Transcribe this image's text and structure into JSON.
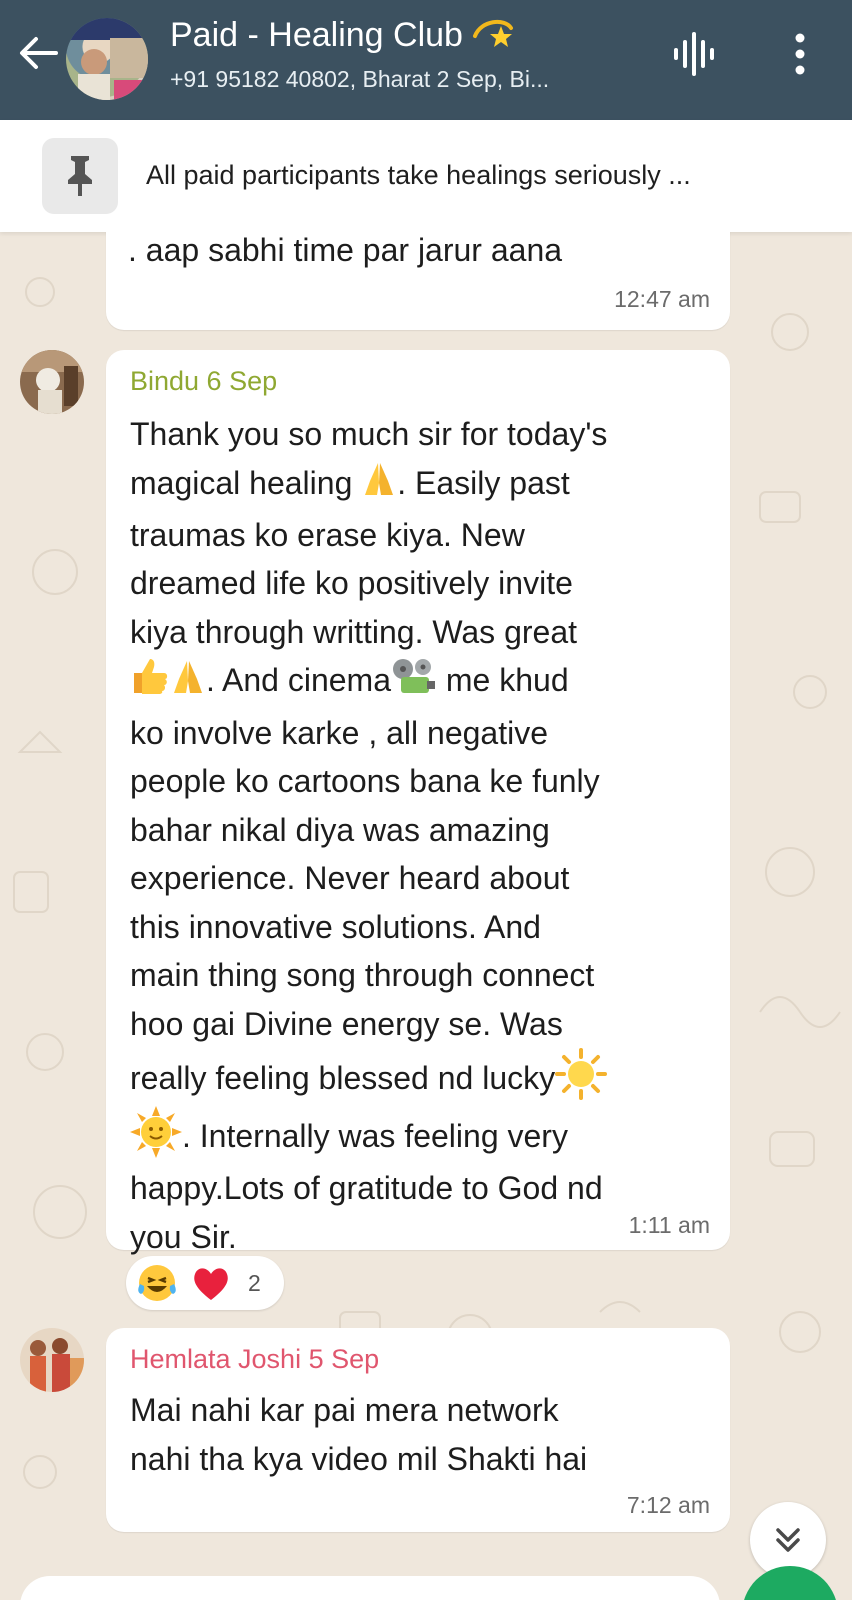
{
  "header": {
    "title": "Paid - Healing Club",
    "subtitle": "+91 95182 40802, Bharat 2 Sep, Bi..."
  },
  "pinned": {
    "text": "All paid participants take healings seriously ..."
  },
  "messages": [
    {
      "text": ". aap sabhi time par jarur aana",
      "time": "12:47 am"
    },
    {
      "sender": "Bindu 6 Sep",
      "sender_color": "#8fa832",
      "lines": [
        "Thank you so much sir for today's",
        "magical healing",
        ".  Easily past",
        "traumas ko erase kiya. New",
        "dreamed life ko positively invite",
        "kiya through writting. Was great",
        ". And cinema",
        " me khud",
        "ko involve karke , all negative",
        "people ko cartoons bana ke funly",
        "bahar nikal diya was amazing",
        "experience. Never heard about",
        "this innovative solutions. And",
        "main thing song through connect",
        "hoo gai Divine energy se. Was",
        "really feeling blessed nd lucky",
        ".   Internally was feeling very",
        "happy.Lots of gratitude to God nd",
        "you Sir."
      ],
      "time": "1:11 am",
      "reactions": {
        "count": "2",
        "emoji": [
          "laughing-tears",
          "red-heart"
        ]
      }
    },
    {
      "sender": "Hemlata Joshi 5 Sep",
      "sender_color": "#e0566e",
      "lines": [
        "Mai  nahi kar pai mera network",
        "nahi tha kya video mil Shakti hai"
      ],
      "time": "7:12 am"
    }
  ],
  "colors": {
    "topbar": "#3c5160",
    "chat_bg": "#efe7dc",
    "fab": "#1daa61"
  }
}
